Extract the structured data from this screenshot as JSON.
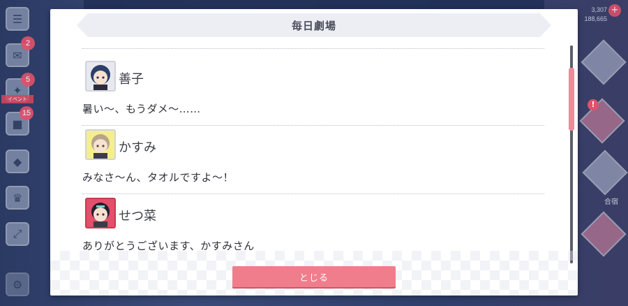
{
  "modal": {
    "title": "毎日劇場",
    "close_label": "とじる"
  },
  "dialog": [
    {
      "speaker": "善子",
      "line": "暑い〜、もうダメ〜……",
      "avatar_color": "#2b3f6a"
    },
    {
      "speaker": "かすみ",
      "line": "みなさ〜ん、タオルですよ〜！",
      "avatar_color": "#f4ef8a"
    },
    {
      "speaker": "せつ菜",
      "line": "ありがとうございます、かすみさん",
      "avatar_color": "#e2506b"
    }
  ],
  "background": {
    "badges": [
      "2",
      "5",
      "15"
    ],
    "currency": [
      "3,307",
      "188,665"
    ],
    "event_tag": "イベント",
    "right_label": "合宿",
    "alert": "!"
  },
  "colors": {
    "accent": "#f07d8c",
    "scroll_thumb": "#f08a98",
    "header_bg": "#eceef4"
  }
}
